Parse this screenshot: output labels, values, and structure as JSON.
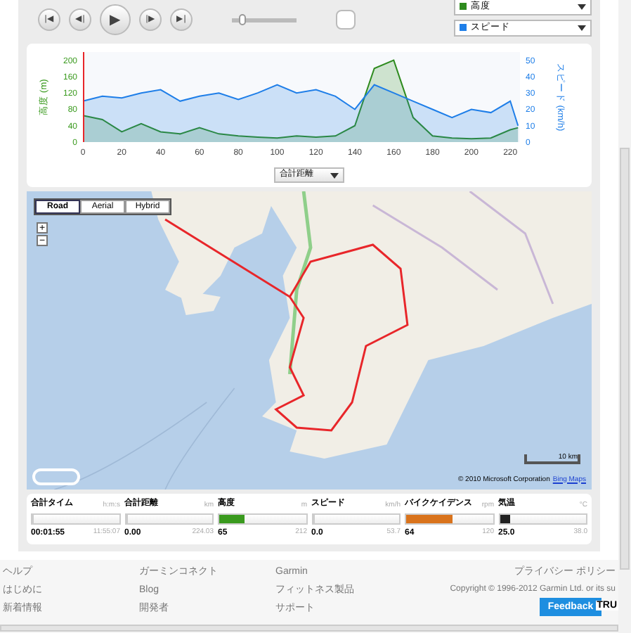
{
  "player": {
    "buttons": [
      {
        "kind": "first",
        "label": "|◀"
      },
      {
        "kind": "back",
        "label": "◀|"
      },
      {
        "kind": "play",
        "label": "▶"
      },
      {
        "kind": "forward",
        "label": "|▶"
      },
      {
        "kind": "last",
        "label": "▶|"
      }
    ],
    "speed_slider": {
      "level": 0.1
    }
  },
  "chart": {
    "chart_data": {
      "type": "area",
      "xlabel": "合計距離",
      "ylabel": "高度 (m)",
      "y2label": "スピード (km/h)",
      "x": [
        0,
        10,
        20,
        30,
        40,
        50,
        60,
        70,
        80,
        90,
        100,
        110,
        120,
        130,
        140,
        150,
        160,
        170,
        180,
        190,
        200,
        210,
        220,
        224
      ],
      "series": [
        {
          "name": "高度",
          "color": "#2e8b1e",
          "axis": "y",
          "values": [
            65,
            55,
            25,
            45,
            25,
            20,
            35,
            20,
            15,
            12,
            10,
            15,
            12,
            15,
            40,
            180,
            200,
            60,
            15,
            10,
            8,
            10,
            30,
            35
          ]
        },
        {
          "name": "スピード",
          "color": "#1e7ee8",
          "axis": "y2",
          "values": [
            25,
            28,
            27,
            30,
            32,
            25,
            28,
            30,
            26,
            30,
            35,
            30,
            32,
            28,
            20,
            35,
            30,
            25,
            20,
            15,
            20,
            18,
            25,
            10
          ]
        }
      ],
      "xlim": [
        0,
        225
      ],
      "ylim": [
        0,
        220
      ],
      "y2lim": [
        0,
        55
      ],
      "xticks": [
        0,
        20,
        40,
        60,
        80,
        100,
        120,
        140,
        160,
        180,
        200,
        220
      ],
      "yticks": [
        0,
        40,
        80,
        120,
        160,
        200
      ],
      "y2ticks": [
        0,
        10,
        20,
        30,
        40,
        50
      ]
    }
  },
  "map": {
    "kind": "picture",
    "modes": [
      {
        "label": "Road",
        "selected": true
      },
      {
        "label": "Aerial",
        "selected": false
      },
      {
        "label": "Hybrid",
        "selected": false
      }
    ],
    "zoom_in": "+",
    "zoom_out": "−",
    "scale": "10 km",
    "copyright": "© 2010 Microsoft Corporation",
    "copyright_link": "Bing Maps"
  },
  "stats": [
    {
      "label": "合計タイム",
      "unit": "h:m:s",
      "value": "00:01:55",
      "max": "11:55:07",
      "level": 0
    },
    {
      "label": "合計距離",
      "unit": "km",
      "value": "0.00",
      "max": "224.03",
      "level": 0
    },
    {
      "label": "高度",
      "unit": "m",
      "value": "65",
      "max": "212",
      "level": 0.3,
      "color": "#3a9a1e"
    },
    {
      "label": "スピード",
      "unit": "km/h",
      "value": "0.0",
      "max": "53.7",
      "level": 0
    },
    {
      "label": "バイクケイデンス",
      "unit": "rpm",
      "value": "64",
      "max": "120",
      "level": 0.53,
      "color": "#d9731c"
    },
    {
      "label": "気温",
      "unit": "°C",
      "value": "25.0",
      "max": "38.0",
      "level": 0.12,
      "color": "#222222"
    }
  ],
  "footer": {
    "columns": [
      [
        "ヘルプ",
        "はじめに",
        "新着情報"
      ],
      [
        "ガーミンコネクト",
        "Blog",
        "開発者"
      ],
      [
        "Garmin",
        "フィットネス製品",
        "サポート"
      ]
    ],
    "privacy": "プライバシー ポリシー",
    "copyright": "Copyright © 1996-2012 Garmin Ltd. or its su",
    "feedback": "Feedback",
    "cut_text": "TRU"
  }
}
